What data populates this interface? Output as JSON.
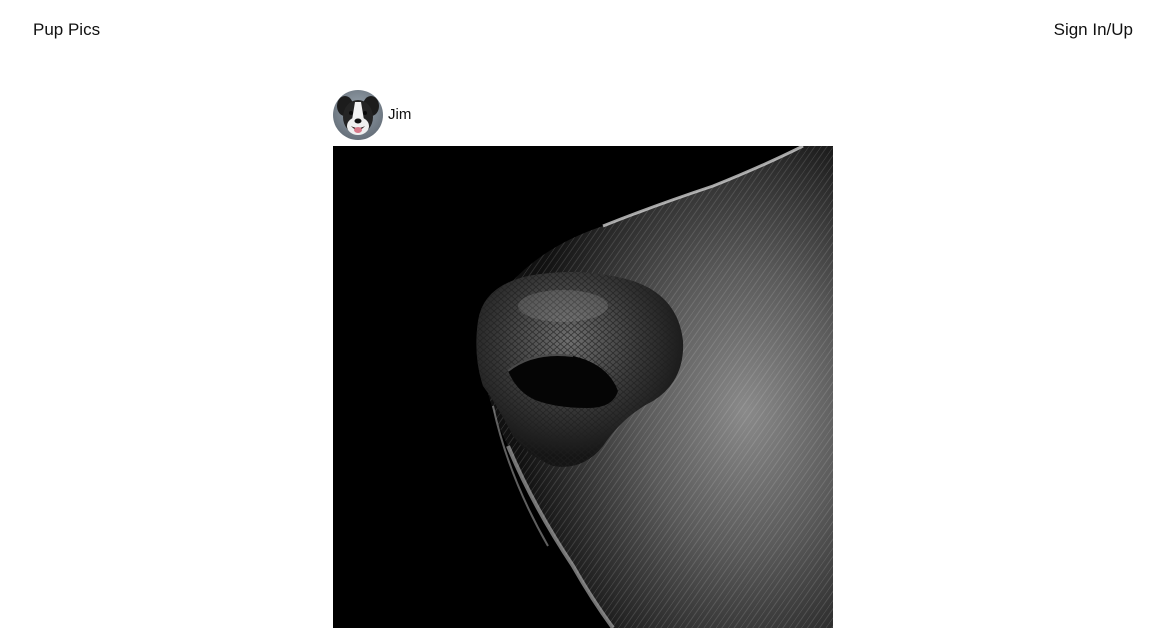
{
  "header": {
    "brand": "Pup Pics",
    "auth_link": "Sign In/Up"
  },
  "post": {
    "author": {
      "name": "Jim",
      "avatar_icon": "dog-avatar"
    },
    "photo": {
      "subject_icon": "dog-nose-photo",
      "style": "black-and-white"
    }
  }
}
